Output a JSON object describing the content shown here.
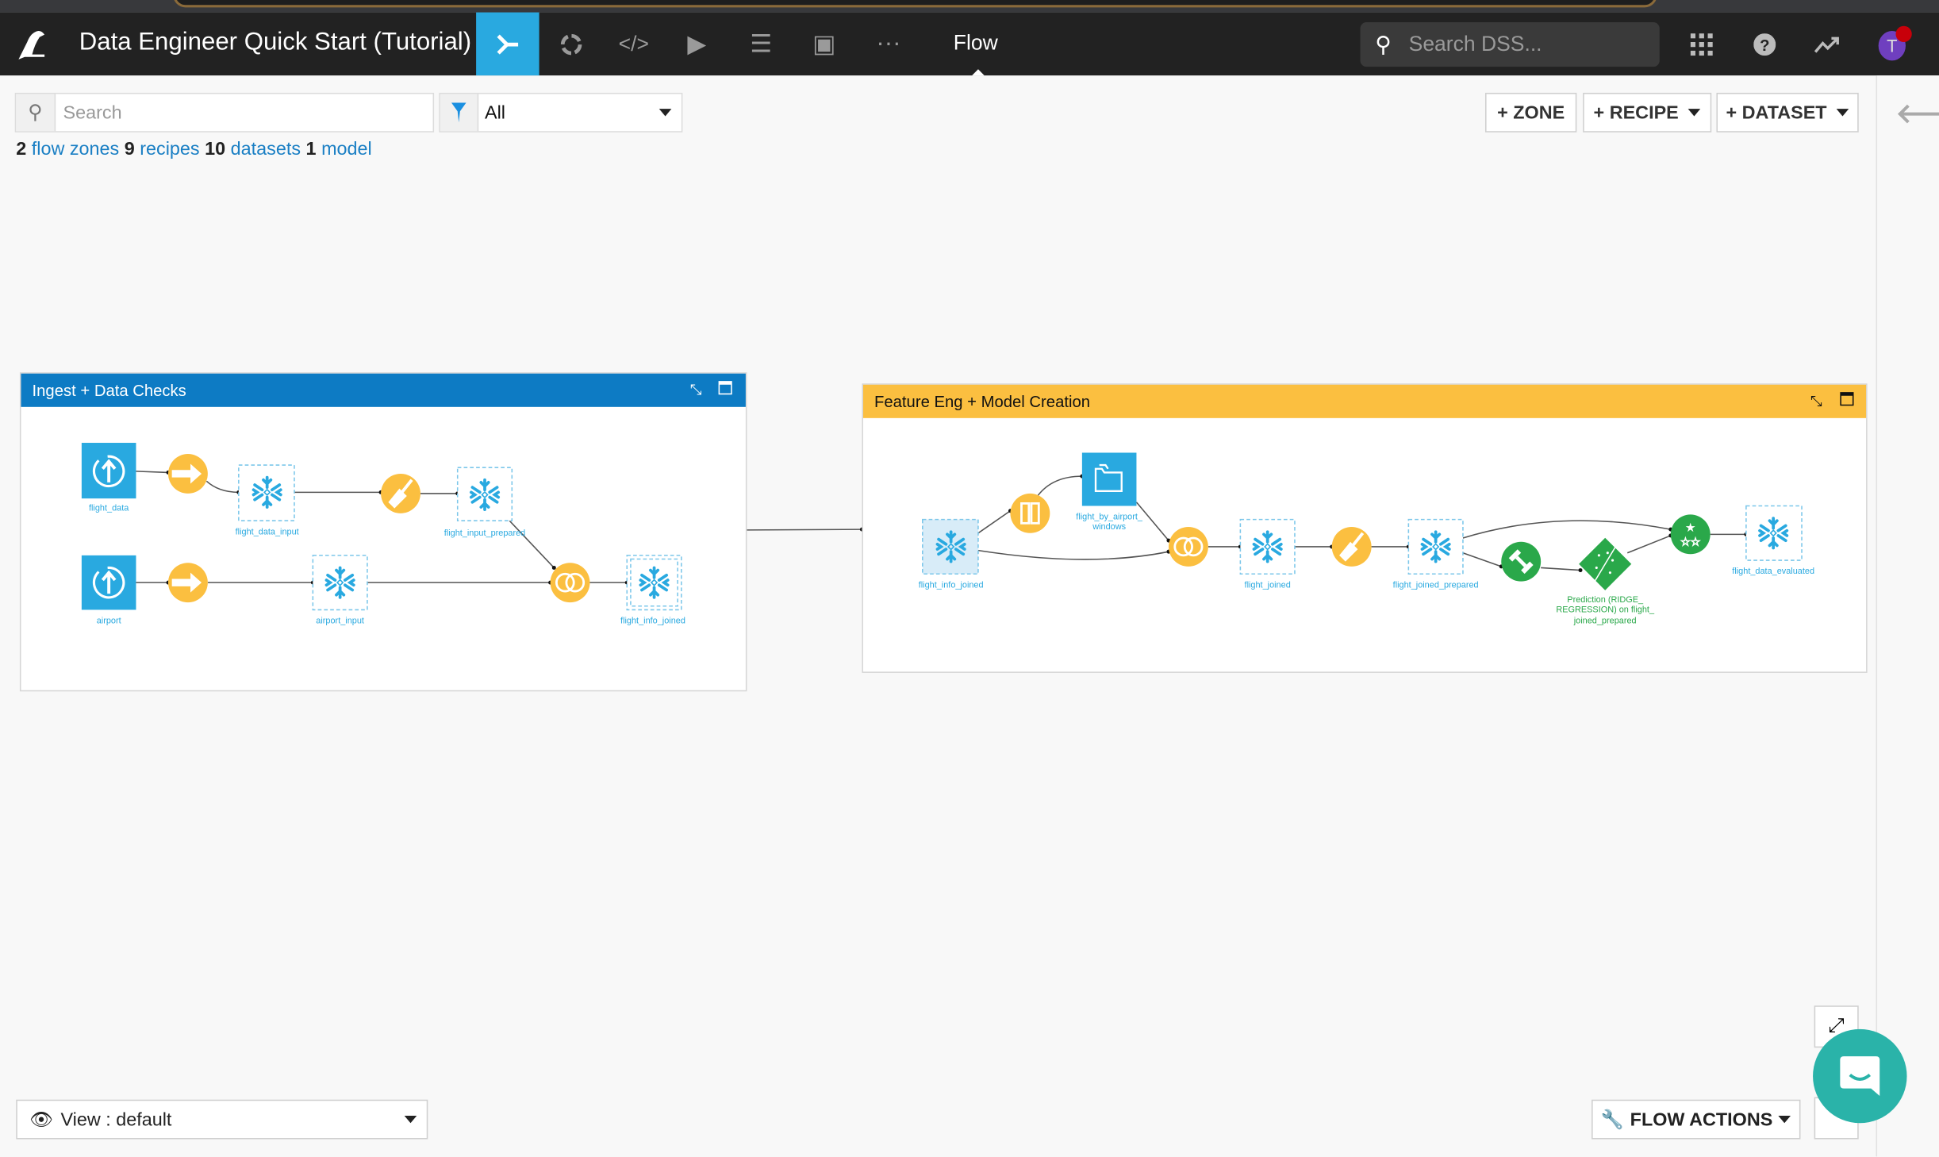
{
  "app": {
    "title": "Data Engineer Quick Start (Tutorial)",
    "current_view": "Flow",
    "search_placeholder": "Search DSS...",
    "avatar_initial": "T"
  },
  "nav_icons": [
    "flow-icon",
    "lab-icon",
    "code-icon",
    "run-icon",
    "stack-icon",
    "dashboard-icon",
    "more-icon"
  ],
  "toolbar": {
    "search_placeholder": "Search",
    "filter_value": "All",
    "zone_button": "+ ZONE",
    "recipe_button": "+ RECIPE",
    "dataset_button": "+ DATASET"
  },
  "summary": {
    "zones_count": "2",
    "zones_label": "flow zones",
    "recipes_count": "9",
    "recipes_label": "recipes",
    "datasets_count": "10",
    "datasets_label": "datasets",
    "models_count": "1",
    "models_label": "model"
  },
  "zones": [
    {
      "title": "Ingest + Data Checks",
      "color": "#0d7bc4",
      "labels": {
        "flight_data": "flight_data",
        "flight_data_input": "flight_data_input",
        "flight_input_prepared": "flight_input_prepared",
        "airport": "airport",
        "airport_input": "airport_input",
        "flight_info_joined": "flight_info_joined"
      }
    },
    {
      "title": "Feature Eng + Model Creation",
      "color": "#fbbf40",
      "labels": {
        "flight_info_joined": "flight_info_joined",
        "windows_folder": [
          "flight_by_airport_",
          "windows"
        ],
        "flight_joined": "flight_joined",
        "flight_joined_prepared": "flight_joined_prepared",
        "model": [
          "Prediction (RIDGE_",
          "REGRESSION) on flight_",
          "joined_prepared"
        ],
        "flight_data_evaluated": "flight_data_evaluated"
      }
    }
  ],
  "bottom": {
    "view_label": "View : default",
    "flow_actions": "FLOW ACTIONS"
  },
  "colors": {
    "accent": "#29a9e0",
    "recipe": "#fbbf40",
    "ml": "#2aa84a",
    "avatar": "#6f3fbf",
    "chat": "#2ab3a9"
  }
}
